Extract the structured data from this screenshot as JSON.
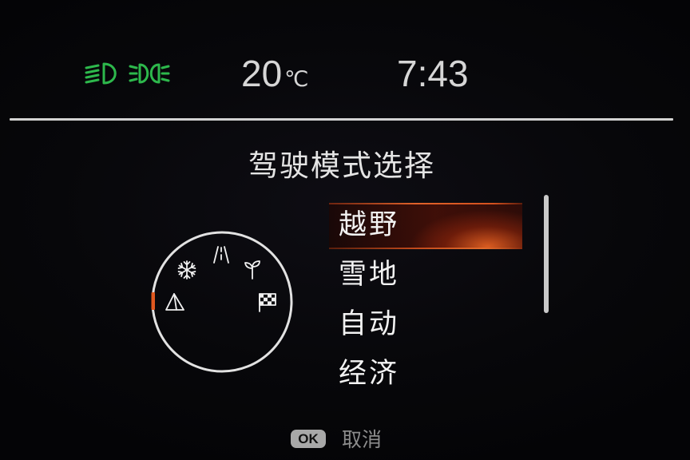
{
  "colors": {
    "indicator_green": "#2db84c",
    "accent_orange": "#e0581f",
    "text": "#f2f2f2",
    "muted": "#8c8c8c"
  },
  "status_bar": {
    "indicators": [
      "low-beam-headlight-icon",
      "position-lights-icon"
    ],
    "temperature": "20",
    "temperature_unit": "℃",
    "time": "7:43"
  },
  "menu": {
    "title": "驾驶模式选择",
    "items": [
      {
        "label": "越野",
        "selected": true
      },
      {
        "label": "雪地",
        "selected": false
      },
      {
        "label": "自动",
        "selected": false
      },
      {
        "label": "经济",
        "selected": false
      }
    ]
  },
  "dial": {
    "icons": [
      "snowflake-icon",
      "road-icon",
      "eco-sprout-icon",
      "mountain-icon",
      "checkered-flag-icon"
    ],
    "selected_icon": "mountain-icon"
  },
  "footer": {
    "ok_key": "OK",
    "cancel_label": "取消"
  }
}
